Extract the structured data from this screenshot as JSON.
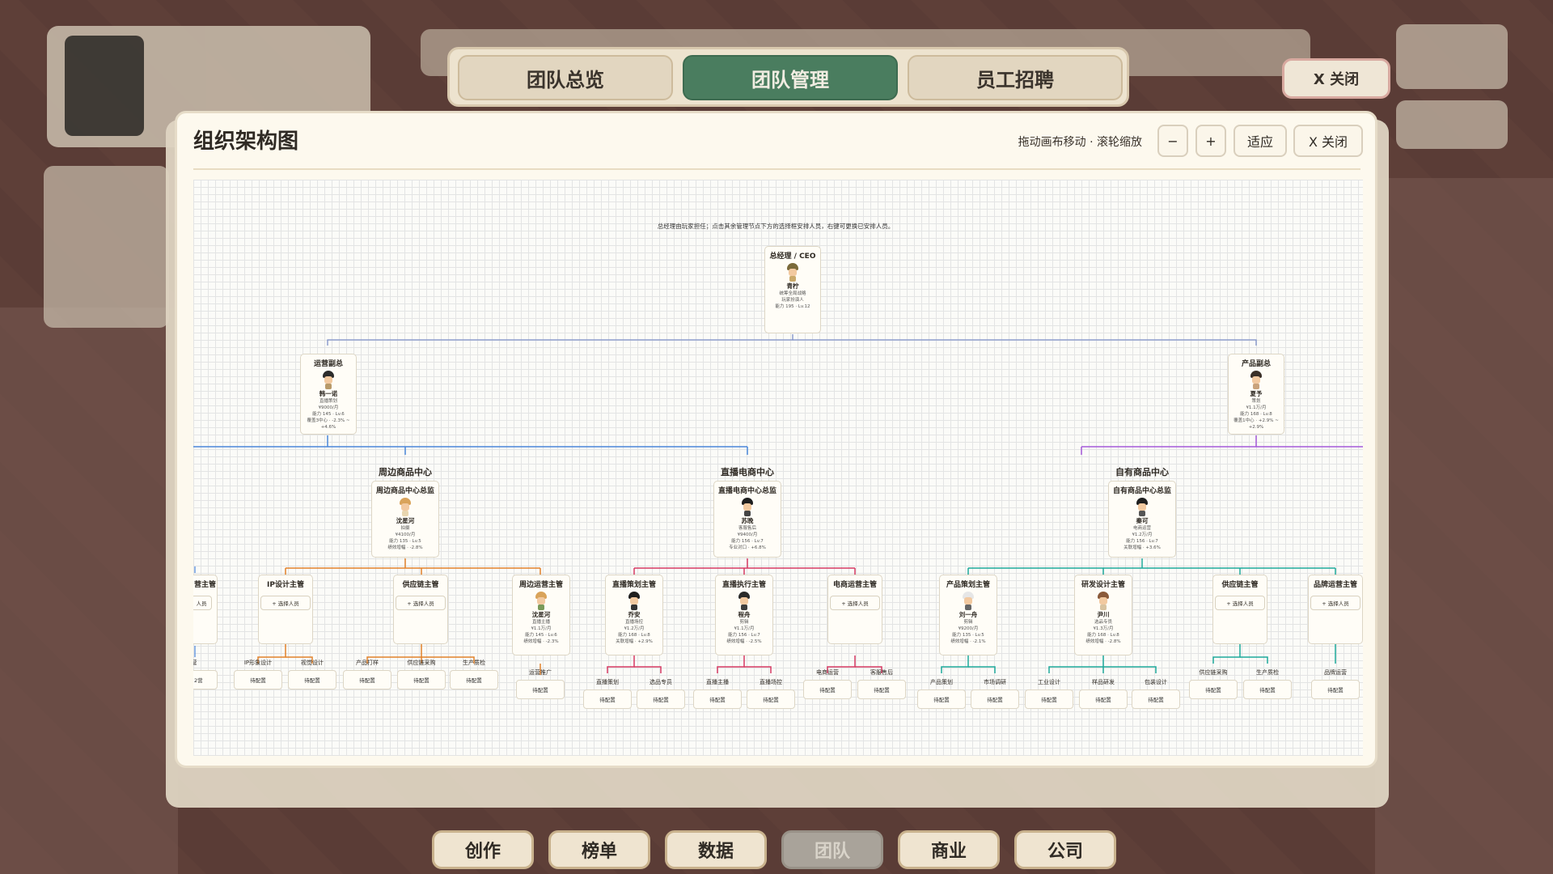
{
  "tabs": {
    "overview": "团队总览",
    "manage": "团队管理",
    "recruit": "员工招聘"
  },
  "top_close": "X 关闭",
  "modal": {
    "title": "组织架构图",
    "hint": "拖动画布移动 · 滚轮缩放",
    "zoom_out": "−",
    "zoom_in": "+",
    "fit": "适应",
    "close": "X 关闭"
  },
  "chart": {
    "note": "总经理由玩家担任；点击其余管理节点下方的选择框安排人员，右键可更换已安排人员。",
    "ceo": {
      "role": "总经理 / CEO",
      "name": "青柠",
      "lines": [
        "统筹全局战略",
        "玩家扮演人",
        "能力 195 · Lv.12"
      ]
    },
    "vp_ops": {
      "role": "运营副总",
      "name": "韩一诺",
      "lines": [
        "直播策划",
        "¥9000/月",
        "能力 145 · Lv.6",
        "覆盖3中心 · -2.3% ~ +4.6%"
      ]
    },
    "vp_prod": {
      "role": "产品副总",
      "name": "夏予",
      "lines": [
        "策划",
        "¥1.1万/月",
        "能力 168 · Lv.8",
        "覆盖1中心 · +2.9% ~ +2.9%"
      ]
    },
    "centers": [
      {
        "title": "周边商品中心",
        "head_role": "周边商品中心总监",
        "name": "沈星河",
        "lines": [
          "拍摄",
          "¥4100/月",
          "能力 135 · Lv.5",
          "绩效增幅 · -2.8%"
        ]
      },
      {
        "title": "直播电商中心",
        "head_role": "直播电商中心总监",
        "name": "苏晚",
        "lines": [
          "客服售后",
          "¥9400/月",
          "能力 156 · Lv.7",
          "专业对口 · +6.8%"
        ]
      },
      {
        "title": "自有商品中心",
        "head_role": "自有商品中心总监",
        "name": "秦可",
        "lines": [
          "电商运营",
          "¥1.2万/月",
          "能力 156 · Lv.7",
          "关联增幅 · +3.6%"
        ]
      }
    ],
    "managers": [
      {
        "role": "IP设计主管",
        "select": "+ 选择人员"
      },
      {
        "role": "供应链主管",
        "select": "+ 选择人员"
      },
      {
        "role": "周边运营主管",
        "name": "沈星河",
        "lines": [
          "直播主播",
          "¥1.1万/月",
          "能力 145 · Lv.6",
          "绩效增幅 · -2.3%"
        ]
      },
      {
        "role": "直播策划主管",
        "name": "乔安",
        "lines": [
          "直播场控",
          "¥1.2万/月",
          "能力 168 · Lv.8",
          "关联增幅 · +2.9%"
        ]
      },
      {
        "role": "直播执行主管",
        "name": "程舟",
        "lines": [
          "剪辑",
          "¥1.1万/月",
          "能力 156 · Lv.7",
          "绩效增幅 · -2.5%"
        ]
      },
      {
        "role": "电商运营主管",
        "select": "+ 选择人员"
      },
      {
        "role": "产品策划主管",
        "name": "刘一舟",
        "lines": [
          "剪辑",
          "¥9200/月",
          "能力 135 · Lv.5",
          "绩效增幅 · -2.1%"
        ]
      },
      {
        "role": "研发设计主管",
        "name": "尹川",
        "lines": [
          "选品专员",
          "¥1.3万/月",
          "能力 168 · Lv.8",
          "绩效增幅 · -2.8%"
        ]
      },
      {
        "role": "供应链主管",
        "select": "+ 选择人员"
      },
      {
        "role": "品牌运营主管",
        "select": "+ 选择人员"
      }
    ],
    "partial_left": {
      "role": "营主管",
      "select": "人员",
      "leaf": "营",
      "leaf2": "2营"
    },
    "leaves": [
      {
        "label": "IP形象设计",
        "status": "待配置"
      },
      {
        "label": "视觉设计",
        "status": "待配置"
      },
      {
        "label": "产品打样",
        "status": "待配置"
      },
      {
        "label": "供应链采购",
        "status": "待配置"
      },
      {
        "label": "生产质检",
        "status": "待配置"
      },
      {
        "label": "运营推广",
        "status": "待配置"
      },
      {
        "label": "直播策划",
        "status": "待配置"
      },
      {
        "label": "选品专员",
        "status": "待配置"
      },
      {
        "label": "直播主播",
        "status": "待配置"
      },
      {
        "label": "直播场控",
        "status": "待配置"
      },
      {
        "label": "电商运营",
        "status": "待配置"
      },
      {
        "label": "客服售后",
        "status": "待配置"
      },
      {
        "label": "产品策划",
        "status": "待配置"
      },
      {
        "label": "市场调研",
        "status": "待配置"
      },
      {
        "label": "工业设计",
        "status": "待配置"
      },
      {
        "label": "样品研发",
        "status": "待配置"
      },
      {
        "label": "包装设计",
        "status": "待配置"
      },
      {
        "label": "供应链采购",
        "status": "待配置"
      },
      {
        "label": "生产质检",
        "status": "待配置"
      },
      {
        "label": "品牌运营",
        "status": "待配置"
      }
    ]
  },
  "bottom_nav": [
    "创作",
    "榜单",
    "数据",
    "团队",
    "商业",
    "公司"
  ],
  "colors": {
    "accent": "#4a7d5f",
    "ops_line": "#4a86d9",
    "prod_line": "#a45ad9",
    "peripheral": "#e2822b",
    "live": "#d63b63",
    "own": "#1ea99b"
  }
}
